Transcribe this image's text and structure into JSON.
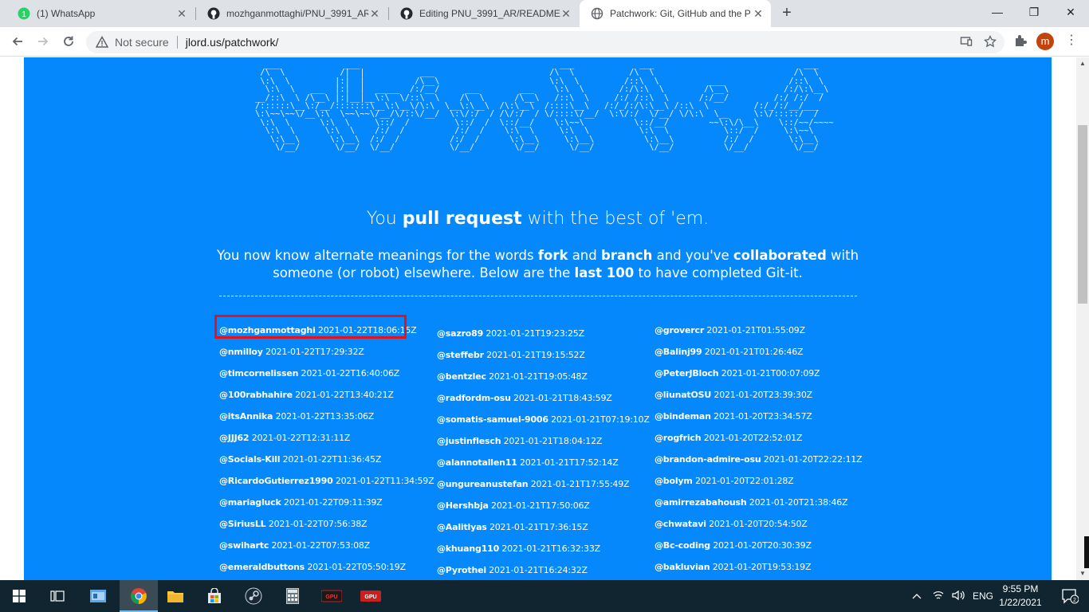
{
  "browser": {
    "tabs": [
      {
        "title": "(1) WhatsApp",
        "icon": "whatsapp-icon",
        "active": false
      },
      {
        "title": "mozhganmottaghi/PNU_3991_AR",
        "icon": "github-icon",
        "active": false
      },
      {
        "title": "Editing PNU_3991_AR/README.md",
        "icon": "github-icon",
        "active": false
      },
      {
        "title": "Patchwork: Git, GitHub and the P",
        "icon": "globe-icon",
        "active": true
      }
    ],
    "new_tab": "+",
    "window_controls": {
      "minimize": "—",
      "restore": "❐",
      "close": "✕"
    },
    "security_label": "Not secure",
    "url": "jlord.us/patchwork/",
    "avatar_letter": "m",
    "colors": {
      "tabstrip": "#dee1e6",
      "avatar": "#c1440e"
    }
  },
  "page": {
    "background": "#0488fc",
    "ascii_art": "     ___           ___           ___           ___           ___           ___           ___                    ___           ___           ___                       ___\n    /\\  \\         /\\__\\         /\\__\\         /\\__\\         /\\  \\         /\\  \\         /\\  \\                  /\\__\\         /\\  \\         /\\__\\                     /\\  \\\n   /::\\  \\       /:/  /        /:/  /        /:/  /        /::\\  \\       /::\\  \\       /::\\  \\                /:/ _/_       /::\\  \\       /:/  /        ___         /::\\  \\",
    "headline": {
      "pre": "You ",
      "bold": "pull request",
      "post": " with the best of 'em."
    },
    "subtext": {
      "t1": "You now know alternate meanings for the words ",
      "b1": "fork",
      "t2": " and ",
      "b2": "branch",
      "t3": " and you've ",
      "b3": "collaborated",
      "t4": " with someone (or robot) elsewhere. Below are the ",
      "b4": "last 100",
      "t5": " to have completed Git-it."
    },
    "columns": [
      [
        {
          "user": "@mozhganmottaghi",
          "time": "2021-01-22T18:06:15Z"
        },
        {
          "user": "@nmilloy",
          "time": "2021-01-22T17:29:32Z"
        },
        {
          "user": "@timcornelissen",
          "time": "2021-01-22T16:40:06Z"
        },
        {
          "user": "@100rabhahire",
          "time": "2021-01-22T13:40:21Z"
        },
        {
          "user": "@itsAnnika",
          "time": "2021-01-22T13:35:06Z"
        },
        {
          "user": "@JJJ62",
          "time": "2021-01-22T12:31:11Z"
        },
        {
          "user": "@Socials-Kill",
          "time": "2021-01-22T11:36:45Z"
        },
        {
          "user": "@RicardoGutierrez1990",
          "time": "2021-01-22T11:34:59Z"
        },
        {
          "user": "@mariagluck",
          "time": "2021-01-22T09:11:39Z"
        },
        {
          "user": "@SiriusLL",
          "time": "2021-01-22T07:56:38Z"
        },
        {
          "user": "@swihartc",
          "time": "2021-01-22T07:53:08Z"
        },
        {
          "user": "@emeraldbuttons",
          "time": "2021-01-22T05:50:19Z"
        }
      ],
      [
        {
          "user": "@sazro89",
          "time": "2021-01-21T19:23:25Z"
        },
        {
          "user": "@steffebr",
          "time": "2021-01-21T19:15:52Z"
        },
        {
          "user": "@bentzlec",
          "time": "2021-01-21T19:05:48Z"
        },
        {
          "user": "@radfordm-osu",
          "time": "2021-01-21T18:43:59Z"
        },
        {
          "user": "@somatis-samuel-9006",
          "time": "2021-01-21T07:19:10Z"
        },
        {
          "user": "@justinflesch",
          "time": "2021-01-21T18:04:12Z"
        },
        {
          "user": "@alannotallen11",
          "time": "2021-01-21T17:52:14Z"
        },
        {
          "user": "@ungureanustefan",
          "time": "2021-01-21T17:55:49Z"
        },
        {
          "user": "@Hershbja",
          "time": "2021-01-21T17:50:06Z"
        },
        {
          "user": "@Aalitlyas",
          "time": "2021-01-21T17:36:15Z"
        },
        {
          "user": "@khuang110",
          "time": "2021-01-21T16:32:33Z"
        },
        {
          "user": "@Pyrothei",
          "time": "2021-01-21T16:24:32Z"
        }
      ],
      [
        {
          "user": "@grovercr",
          "time": "2021-01-21T01:55:09Z"
        },
        {
          "user": "@Balinj99",
          "time": "2021-01-21T01:26:46Z"
        },
        {
          "user": "@PeterJBloch",
          "time": "2021-01-21T00:07:09Z"
        },
        {
          "user": "@liunatOSU",
          "time": "2021-01-20T23:39:30Z"
        },
        {
          "user": "@bindeman",
          "time": "2021-01-20T23:34:57Z"
        },
        {
          "user": "@rogfrich",
          "time": "2021-01-20T22:52:01Z"
        },
        {
          "user": "@brandon-admire-osu",
          "time": "2021-01-20T22:22:11Z"
        },
        {
          "user": "@bolym",
          "time": "2021-01-20T22:01:28Z"
        },
        {
          "user": "@amirrezabahoush",
          "time": "2021-01-20T21:38:46Z"
        },
        {
          "user": "@chwatavi",
          "time": "2021-01-20T20:54:50Z"
        },
        {
          "user": "@Bc-coding",
          "time": "2021-01-20T20:30:39Z"
        },
        {
          "user": "@bakluvian",
          "time": "2021-01-20T19:53:19Z"
        }
      ]
    ],
    "highlight_color": "#e2141b"
  },
  "taskbar": {
    "apps": [
      "windows-start-icon",
      "task-view-icon",
      "control-panel-icon",
      "chrome-icon",
      "file-explorer-icon",
      "store-icon",
      "steam-icon",
      "calculator-icon",
      "gpu-tweak-icon",
      "gpu-tweak-2-icon"
    ],
    "language": "ENG",
    "time": "9:55 PM",
    "date": "1/22/2021",
    "notification_count": "2"
  }
}
